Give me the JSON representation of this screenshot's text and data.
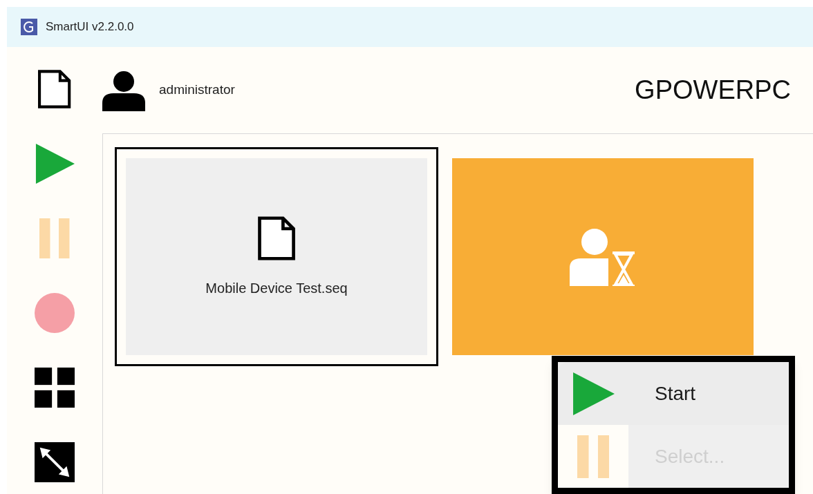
{
  "window": {
    "title": "SmartUI v2.2.0.0"
  },
  "sidebar": {
    "items": [
      {
        "kind": "new",
        "disabled": false
      },
      {
        "kind": "play",
        "disabled": false
      },
      {
        "kind": "pause",
        "disabled": true
      },
      {
        "kind": "record",
        "disabled": true
      },
      {
        "kind": "grid",
        "disabled": false
      },
      {
        "kind": "resize",
        "disabled": false
      }
    ]
  },
  "header": {
    "user": "administrator",
    "machine": "GPOWERPC"
  },
  "tiles": [
    {
      "kind": "file",
      "label": "Mobile Device Test.seq",
      "selected": true
    },
    {
      "kind": "user-wait",
      "selected": false
    }
  ],
  "context_menu": {
    "items": [
      {
        "kind": "play",
        "label": "Start",
        "disabled": false,
        "selected": true
      },
      {
        "kind": "pause",
        "label": "Select...",
        "disabled": true,
        "selected": false
      }
    ]
  }
}
